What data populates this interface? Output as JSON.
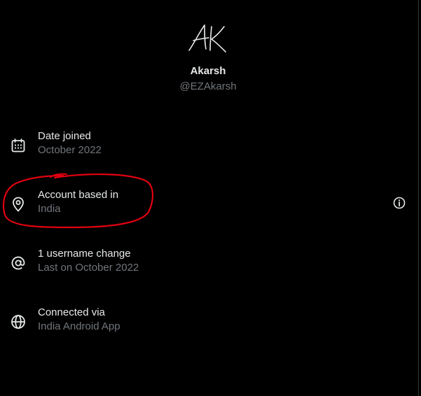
{
  "profile": {
    "display_name": "Akarsh",
    "handle": "@EZAkarsh",
    "avatar_icon": "handwritten-initials-logo",
    "avatar_text": "AK"
  },
  "rows": [
    {
      "icon": "calendar-icon",
      "label": "Date joined",
      "value": "October 2022"
    },
    {
      "icon": "location-pin-icon",
      "label": "Account based in",
      "value": "India"
    },
    {
      "icon": "at-sign-icon",
      "label": "1 username change",
      "value": "Last on October 2022"
    },
    {
      "icon": "globe-icon",
      "label": "Connected via",
      "value": "India Android App"
    }
  ],
  "annotation": {
    "color": "#e0000f",
    "shape": "hand-drawn-circle"
  },
  "colors": {
    "background": "#000000",
    "primary_text": "#e7e9ea",
    "secondary_text": "#71767b"
  }
}
